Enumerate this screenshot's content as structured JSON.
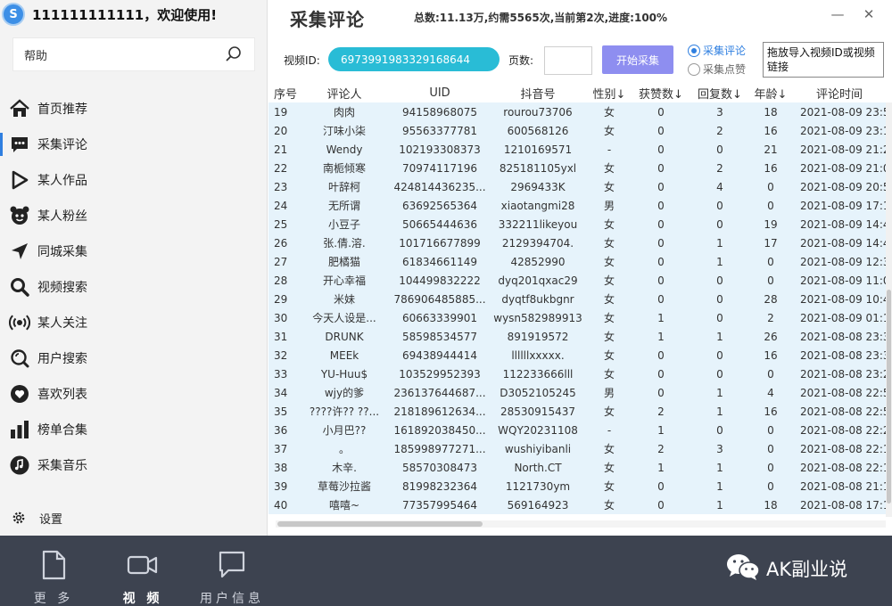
{
  "user": {
    "avatar_letter": "S",
    "name": "111111111111，欢迎使用!"
  },
  "help": {
    "label": "帮助"
  },
  "nav": [
    {
      "label": "首页推荐",
      "icon": "home-icon",
      "active": false
    },
    {
      "label": "采集评论",
      "icon": "comment-icon",
      "active": true
    },
    {
      "label": "某人作品",
      "icon": "play-icon",
      "active": false
    },
    {
      "label": "某人粉丝",
      "icon": "fans-icon",
      "active": false
    },
    {
      "label": "同城采集",
      "icon": "location-arrow-icon",
      "active": false
    },
    {
      "label": "视频搜索",
      "icon": "search-icon",
      "active": false
    },
    {
      "label": "某人关注",
      "icon": "broadcast-icon",
      "active": false
    },
    {
      "label": "用户搜索",
      "icon": "user-search-icon",
      "active": false
    },
    {
      "label": "喜欢列表",
      "icon": "heart-icon",
      "active": false
    },
    {
      "label": "榜单合集",
      "icon": "bar-chart-icon",
      "active": false
    },
    {
      "label": "采集音乐",
      "icon": "music-icon",
      "active": false
    }
  ],
  "settings": {
    "label": "设置"
  },
  "main": {
    "title": "采集评论",
    "stats": "总数:11.13万,约需5565次,当前第2次,进度:100%",
    "minimize": "—",
    "close": "✕"
  },
  "controls": {
    "video_id_label": "视频ID:",
    "video_id_value": "6973991983329168644",
    "pages_label": "页数:",
    "pages_value": "",
    "start_button": "开始采集",
    "radio_comments": "采集评论",
    "radio_likes": "采集点赞",
    "drop_hint": "拖放导入视频ID或视频链接"
  },
  "table": {
    "columns": [
      "序号",
      "评论人",
      "UID",
      "抖音号",
      "性别↓",
      "获赞数↓",
      "回复数↓",
      "年龄↓",
      "评论时间"
    ],
    "rows": [
      [
        "19",
        "肉肉",
        "94158968075",
        "rourou73706",
        "女",
        "0",
        "3",
        "18",
        "2021-08-09 23:5"
      ],
      [
        "20",
        "汀味小柒",
        "95563377781",
        "600568126",
        "女",
        "0",
        "2",
        "16",
        "2021-08-09 23:1"
      ],
      [
        "21",
        "Wendy",
        "102193308373",
        "1210169571",
        "-",
        "0",
        "0",
        "21",
        "2021-08-09 21:2"
      ],
      [
        "22",
        "南栀倾寒",
        "70974117196",
        "825181105yxl",
        "女",
        "0",
        "2",
        "16",
        "2021-08-09 21:0"
      ],
      [
        "23",
        "叶辞柯",
        "424814436235...",
        "2969433K",
        "女",
        "0",
        "4",
        "0",
        "2021-08-09 20:5"
      ],
      [
        "24",
        "无所谓",
        "63692565364",
        "xiaotangmi28",
        "男",
        "0",
        "0",
        "0",
        "2021-08-09 17:1"
      ],
      [
        "25",
        "小豆子",
        "50665444636",
        "332211likeyou",
        "女",
        "0",
        "0",
        "19",
        "2021-08-09 14:4"
      ],
      [
        "26",
        "张.倩.溶.",
        "101716677899",
        "2129394704.",
        "女",
        "0",
        "1",
        "17",
        "2021-08-09 14:4"
      ],
      [
        "27",
        "肥橘猫",
        "61834661149",
        "42852990",
        "女",
        "0",
        "1",
        "0",
        "2021-08-09 12:3"
      ],
      [
        "28",
        "开心幸福",
        "104499832222",
        "dyq201qxac29",
        "女",
        "0",
        "0",
        "0",
        "2021-08-09 11:0"
      ],
      [
        "29",
        "米妹",
        "786906485885...",
        "dyqtf8ukbgnr",
        "女",
        "0",
        "0",
        "28",
        "2021-08-09 10:4"
      ],
      [
        "30",
        "今天人设是...",
        "60663339901",
        "wysn582989913",
        "女",
        "1",
        "0",
        "2",
        "2021-08-09 01:1"
      ],
      [
        "31",
        "DRUNK",
        "58598534577",
        "891919572",
        "女",
        "1",
        "1",
        "26",
        "2021-08-08 23:3"
      ],
      [
        "32",
        "MEEk",
        "69438944414",
        "llllllxxxxx.",
        "女",
        "0",
        "0",
        "16",
        "2021-08-08 23:3"
      ],
      [
        "33",
        "YU-Huu$",
        "103529952393",
        "112233666lll",
        "女",
        "0",
        "0",
        "0",
        "2021-08-08 23:2"
      ],
      [
        "34",
        "wjy的爹",
        "236137644687...",
        "D3052105245",
        "男",
        "0",
        "1",
        "4",
        "2021-08-08 22:5"
      ],
      [
        "35",
        "????许?? ??...",
        "218189612634...",
        "28530915437",
        "女",
        "2",
        "1",
        "16",
        "2021-08-08 22:5"
      ],
      [
        "36",
        "小月巴??",
        "161892038450...",
        "WQY20231108",
        "-",
        "1",
        "0",
        "0",
        "2021-08-08 22:2"
      ],
      [
        "37",
        "。",
        "185998977271...",
        "wushiyibanli",
        "女",
        "2",
        "3",
        "0",
        "2021-08-08 22:1"
      ],
      [
        "38",
        "木辛.",
        "58570308473",
        "North.CT",
        "女",
        "1",
        "1",
        "0",
        "2021-08-08 22:1"
      ],
      [
        "39",
        "草莓沙拉酱",
        "81998232364",
        "1121730ym",
        "女",
        "0",
        "1",
        "0",
        "2021-08-08 21:1"
      ],
      [
        "40",
        "嘻嘻~",
        "77357995464",
        "569164923",
        "女",
        "0",
        "1",
        "18",
        "2021-08-08 17:1"
      ]
    ]
  },
  "bottom": {
    "tabs": [
      {
        "label": "更 多",
        "icon": "document-icon",
        "active": false
      },
      {
        "label": "视 频",
        "icon": "video-camera-icon",
        "active": true
      },
      {
        "label": "用户信息",
        "icon": "chat-bubble-icon",
        "active": false
      }
    ],
    "brand": "AK副业说"
  },
  "colors": {
    "accent": "#2f7fe0",
    "video_id_bg": "#29bcd6",
    "start_button_bg": "#8e8ef0",
    "table_row_bg": "#e6f3fb",
    "bottom_bar_bg": "#3d4350"
  }
}
